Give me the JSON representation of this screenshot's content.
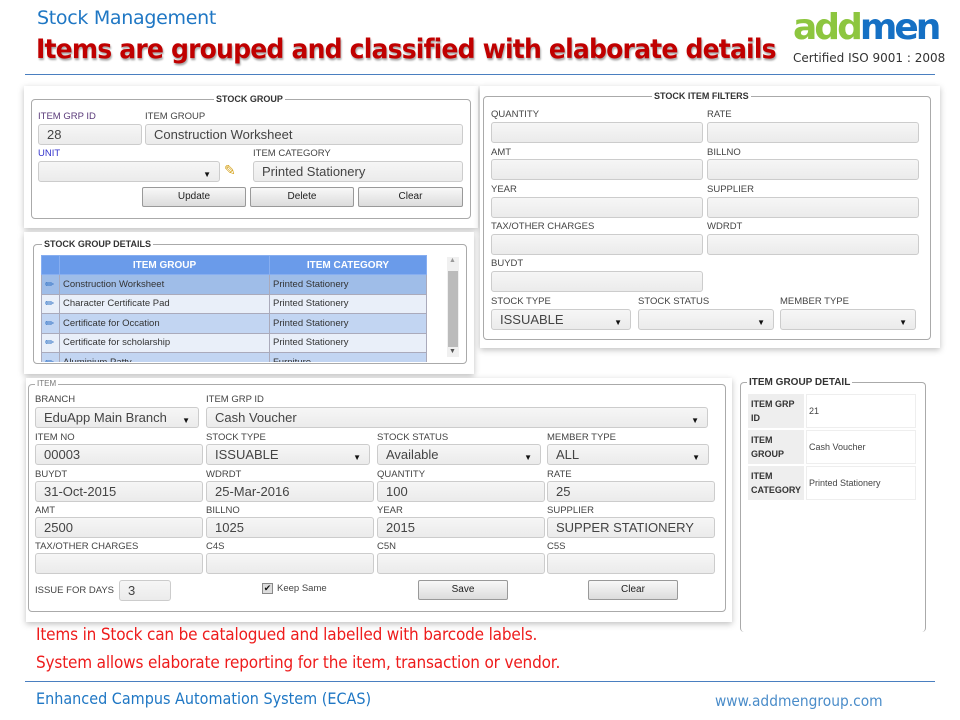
{
  "header": {
    "subtitle": "Stock Management",
    "headline": "Items are grouped and classified with elaborate details",
    "logo": {
      "part1": "add",
      "part2": "men",
      "certification": "Certified ISO 9001 : 2008"
    }
  },
  "stock_group": {
    "legend": "STOCK GROUP",
    "item_grp_id_label": "ITEM GRP ID",
    "item_grp_id_value": "28",
    "item_group_label": "ITEM GROUP",
    "item_group_value": "Construction Worksheet",
    "unit_label": "UNIT",
    "unit_value": "",
    "item_category_label": "ITEM CATEGORY",
    "item_category_value": "Printed Stationery",
    "buttons": {
      "update": "Update",
      "delete": "Delete",
      "clear": "Clear"
    }
  },
  "stock_group_details": {
    "legend": "STOCK GROUP DETAILS",
    "columns": [
      "ITEM GROUP",
      "ITEM CATEGORY"
    ],
    "rows": [
      {
        "item_group": "Construction Worksheet",
        "item_category": "Printed Stationery"
      },
      {
        "item_group": "Character Certificate Pad",
        "item_category": "Printed Stationery"
      },
      {
        "item_group": "Certificate for Occation",
        "item_category": "Printed Stationery"
      },
      {
        "item_group": "Certificate for scholarship",
        "item_category": "Printed Stationery"
      },
      {
        "item_group": "Aluminium Patty",
        "item_category": "Furniture"
      }
    ]
  },
  "filters": {
    "legend": "STOCK ITEM FILTERS",
    "quantity_label": "QUANTITY",
    "quantity_value": "",
    "rate_label": "RATE",
    "rate_value": "",
    "amt_label": "AMT",
    "amt_value": "",
    "billno_label": "BILLNO",
    "billno_value": "",
    "year_label": "YEAR",
    "year_value": "",
    "supplier_label": "SUPPLIER",
    "supplier_value": "",
    "tax_label": "TAX/OTHER CHARGES",
    "tax_value": "",
    "wdrdt_label": "WDRDT",
    "wdrdt_value": "",
    "buydt_label": "BUYDT",
    "buydt_value": "",
    "stock_type_label": "STOCK TYPE",
    "stock_type_value": "ISSUABLE",
    "stock_status_label": "STOCK STATUS",
    "stock_status_value": "",
    "member_type_label": "MEMBER TYPE",
    "member_type_value": ""
  },
  "item": {
    "legend": "ITEM",
    "branch_label": "BRANCH",
    "branch_value": "EduApp Main Branch",
    "item_grp_id_label": "ITEM GRP ID",
    "item_grp_id_value": "Cash Voucher",
    "item_no_label": "ITEM NO",
    "item_no_value": "00003",
    "stock_type_label": "STOCK TYPE",
    "stock_type_value": "ISSUABLE",
    "stock_status_label": "STOCK STATUS",
    "stock_status_value": "Available",
    "member_type_label": "MEMBER TYPE",
    "member_type_value": "ALL",
    "buydt_label": "BUYDT",
    "buydt_value": "31-Oct-2015",
    "wdrdt_label": "WDRDT",
    "wdrdt_value": "25-Mar-2016",
    "quantity_label": "QUANTITY",
    "quantity_value": "100",
    "rate_label": "RATE",
    "rate_value": "25",
    "amt_label": "AMT",
    "amt_value": "2500",
    "billno_label": "BILLNO",
    "billno_value": "1025",
    "year_label": "YEAR",
    "year_value": "2015",
    "supplier_label": "SUPPLIER",
    "supplier_value": "SUPPER STATIONERY",
    "tax_label": "TAX/OTHER CHARGES",
    "tax_value": "",
    "c4s_label": "C4S",
    "c4s_value": "",
    "c5n_label": "C5N",
    "c5n_value": "",
    "c5s_label": "C5S",
    "c5s_value": "",
    "issue_days_label": "ISSUE FOR DAYS",
    "issue_days_value": "3",
    "keep_same_label": "Keep Same",
    "keep_same_checked": true,
    "buttons": {
      "save": "Save",
      "clear": "Clear"
    }
  },
  "item_group_detail": {
    "legend": "ITEM GROUP DETAIL",
    "rows": [
      {
        "key": "ITEM GRP ID",
        "value": "21"
      },
      {
        "key": "ITEM GROUP",
        "value": "Cash Voucher"
      },
      {
        "key": "ITEM CATEGORY",
        "value": "Printed Stationery"
      }
    ]
  },
  "bullets": [
    "Items in Stock can be catalogued and labelled with barcode labels.",
    "System allows elaborate reporting for the item, transaction or vendor."
  ],
  "footer": {
    "left": "Enhanced Campus Automation System (ECAS)",
    "right": "www.addmengroup.com"
  },
  "colors": {
    "headline": "#c00000",
    "accent": "#1f77c4",
    "bullet": "#ee1c1c",
    "grid_header": "#6a9bea"
  }
}
